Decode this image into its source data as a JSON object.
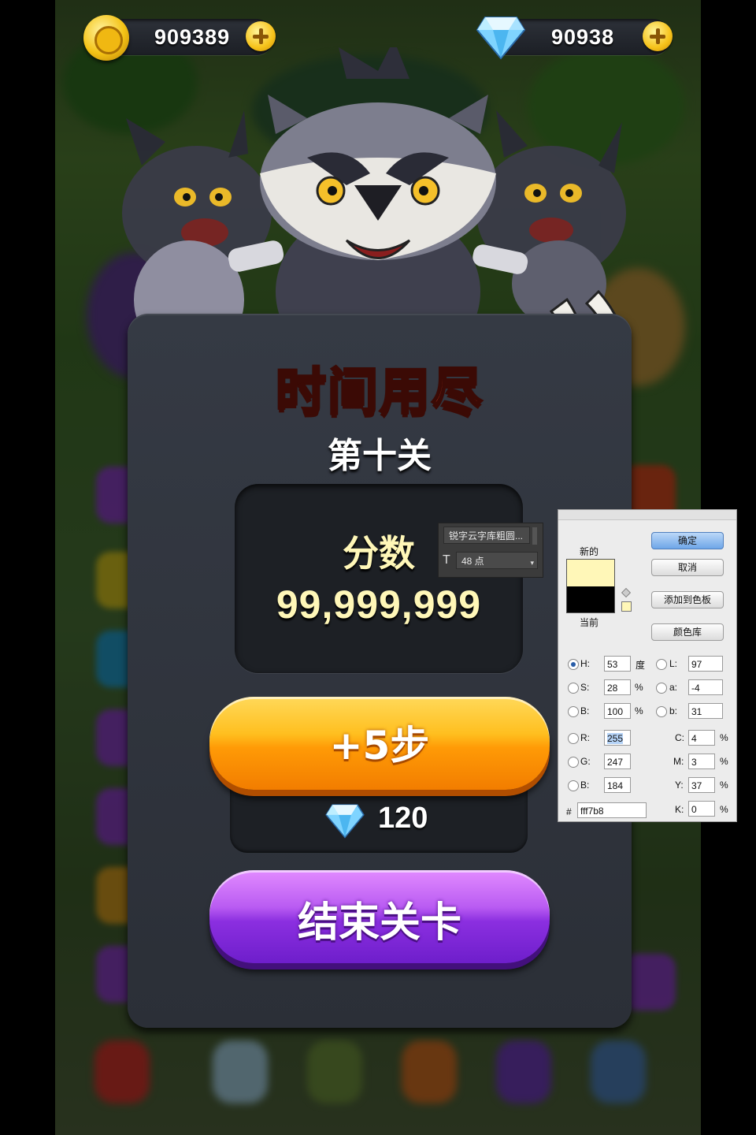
{
  "hud": {
    "coins": "909389",
    "gems": "90938"
  },
  "dialog": {
    "title": "时间用尽",
    "level": "第十关",
    "score_label": "分数",
    "score_value": "99,999,999",
    "add_steps_label": "+5步",
    "add_steps_cost": "120",
    "end_level_label": "结束关卡"
  },
  "font_panel": {
    "font_name": "锐字云字库粗圆...",
    "font_size": "48 点"
  },
  "color_picker": {
    "new_label": "新的",
    "current_label": "当前",
    "ok_button": "确定",
    "cancel_button": "取消",
    "add_swatch_button": "添加到色板",
    "color_library_button": "颜色库",
    "fields": {
      "H": "53",
      "S": "28",
      "B": "100",
      "R": "255",
      "G": "247",
      "B2": "184",
      "L": "97",
      "a": "-4",
      "b": "31",
      "C": "4",
      "M": "3",
      "Y": "37",
      "K": "0"
    },
    "units": {
      "degree": "度",
      "percent": "%"
    },
    "hex_label": "#",
    "hex_value": "fff7b8",
    "new_color": "#fff7b8",
    "current_color": "#000000"
  },
  "colors": {
    "title_red": "#f24b2c",
    "score_cream": "#fff7b8",
    "orange_button": "#ff9a06",
    "purple_button": "#8b2fe0"
  }
}
